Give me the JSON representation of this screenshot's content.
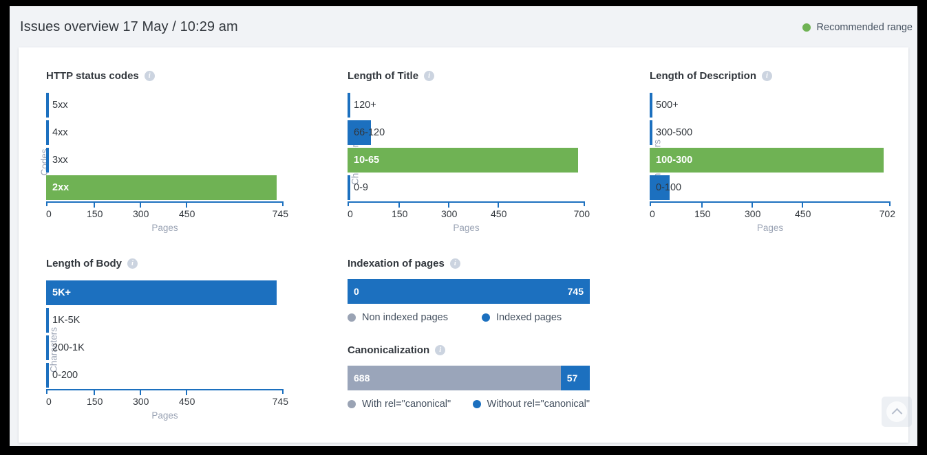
{
  "header": {
    "title": "Issues overview 17 May / 10:29 am",
    "legend_label": "Recommended range",
    "legend_color": "#6fb254"
  },
  "colors": {
    "blue": "#1c70bf",
    "green": "#6fb254",
    "grey": "#9aa5ba",
    "axis": "#1c70bf",
    "muted_text": "#9aa3b4"
  },
  "info_icon_glyph": "i",
  "scroll_top": {
    "icon": "chevron-up-icon"
  },
  "chart_data": [
    {
      "id": "http-status-codes",
      "type": "bar",
      "orientation": "horizontal",
      "title": "HTTP status codes",
      "xlabel": "Pages",
      "ylabel": "Codes",
      "categories": [
        "5xx",
        "4xx",
        "3xx",
        "2xx"
      ],
      "values": [
        0,
        0,
        0,
        745
      ],
      "highlight_category": "2xx",
      "xlim": [
        0,
        745
      ],
      "ticks": [
        0,
        150,
        300,
        450
      ],
      "tick_labels": [
        "0",
        "150",
        "300",
        "450"
      ],
      "max_label": "745",
      "grid": false
    },
    {
      "id": "length-of-title",
      "type": "bar",
      "orientation": "horizontal",
      "title": "Length of Title",
      "xlabel": "Pages",
      "ylabel": "Characters",
      "categories": [
        "120+",
        "66-120",
        "10-65",
        "0-9"
      ],
      "values": [
        0,
        70,
        700,
        0
      ],
      "highlight_category": "10-65",
      "xlim": [
        0,
        700
      ],
      "ticks": [
        0,
        150,
        300,
        450
      ],
      "tick_labels": [
        "0",
        "150",
        "300",
        "450"
      ],
      "max_label": "700",
      "grid": false
    },
    {
      "id": "length-of-description",
      "type": "bar",
      "orientation": "horizontal",
      "title": "Length of Description",
      "xlabel": "Pages",
      "ylabel": "Characters",
      "categories": [
        "500+",
        "300-500",
        "100-300",
        "0-100"
      ],
      "values": [
        0,
        0,
        702,
        57
      ],
      "highlight_category": "100-300",
      "xlim": [
        0,
        702
      ],
      "ticks": [
        0,
        150,
        300,
        450
      ],
      "tick_labels": [
        "0",
        "150",
        "300",
        "450"
      ],
      "max_label": "702",
      "grid": false
    },
    {
      "id": "length-of-body",
      "type": "bar",
      "orientation": "horizontal",
      "title": "Length of Body",
      "xlabel": "Pages",
      "ylabel": "Characters",
      "categories": [
        "5K+",
        "1K-5K",
        "200-1K",
        "0-200"
      ],
      "values": [
        745,
        0,
        0,
        0
      ],
      "highlight_category": "",
      "xlim": [
        0,
        745
      ],
      "ticks": [
        0,
        150,
        300,
        450
      ],
      "tick_labels": [
        "0",
        "150",
        "300",
        "450"
      ],
      "max_label": "745",
      "grid": false
    },
    {
      "id": "indexation-of-pages",
      "type": "bar",
      "orientation": "stacked",
      "title": "Indexation of pages",
      "segments": [
        {
          "label": "Non indexed pages",
          "value": 0,
          "value_text": "0",
          "color": "#9aa5ba"
        },
        {
          "label": "Indexed pages",
          "value": 745,
          "value_text": "745",
          "color": "#1c70bf"
        }
      ]
    },
    {
      "id": "canonicalization",
      "type": "bar",
      "orientation": "stacked",
      "title": "Canonicalization",
      "segments": [
        {
          "label": "With rel=\"canonical\"",
          "value": 688,
          "value_text": "688",
          "color": "#9aa5ba"
        },
        {
          "label": "Without rel=\"canonical\"",
          "value": 57,
          "value_text": "57",
          "color": "#1c70bf"
        }
      ]
    }
  ]
}
